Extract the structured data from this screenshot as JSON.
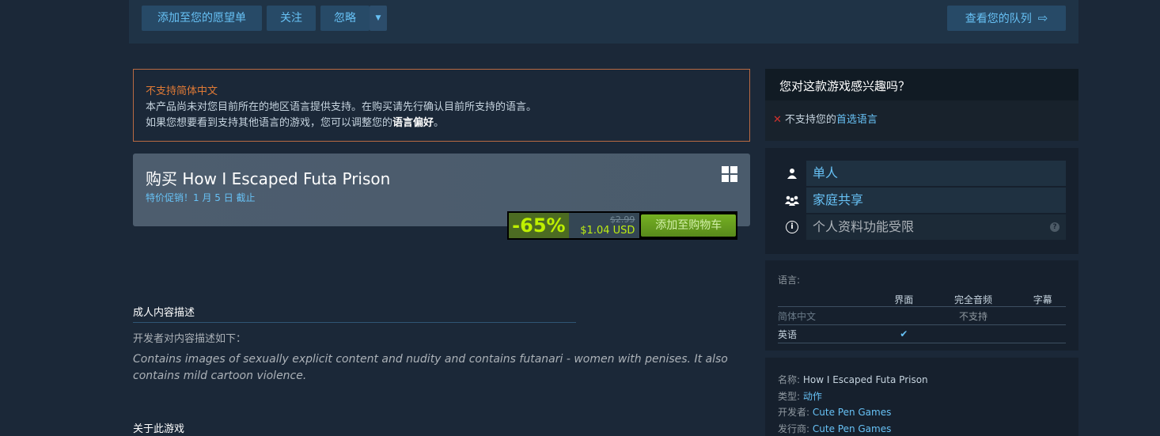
{
  "topbar": {
    "wishlist_label": "添加至您的愿望单",
    "follow_label": "关注",
    "ignore_label": "忽略",
    "queue_label": "查看您的队列"
  },
  "language_warning": {
    "title": "不支持简体中文",
    "line1": "本产品尚未对您目前所在的地区语言提供支持。在购买请先行确认目前所支持的语言。",
    "line2_prefix": "如果您想要看到支持其他语言的游戏，您可以调整您的",
    "line2_link": "语言偏好",
    "line2_suffix": "。"
  },
  "purchase": {
    "title": "购买 How I Escaped Futa Prison",
    "promo": "特价促销！1 月 5 日 截止",
    "discount": "-65%",
    "original_price": "$2.99",
    "final_price": "$1.04 USD",
    "cart_label": "添加至购物车"
  },
  "mature": {
    "heading": "成人内容描述",
    "intro": "开发者对内容描述如下：",
    "text": "Contains images of sexually explicit content and nudity and contains futanari - women with penises. It also contains mild cartoon violence."
  },
  "about": {
    "heading": "关于此游戏"
  },
  "interest": {
    "question": "您对这款游戏感兴趣吗？",
    "not_supported_prefix": "不支持您的",
    "not_supported_link": "首选语言"
  },
  "features": [
    {
      "icon": "single-player-icon",
      "label": "单人"
    },
    {
      "icon": "family-sharing-icon",
      "label": "家庭共享"
    },
    {
      "icon": "info-icon",
      "label": "个人资料功能受限"
    }
  ],
  "languages": {
    "title": "语言:",
    "headers": [
      "界面",
      "完全音频",
      "字幕"
    ],
    "rows": [
      {
        "name": "简体中文",
        "status": "不支持"
      },
      {
        "name": "英语",
        "interface": "✔"
      }
    ]
  },
  "details": {
    "name_key": "名称:",
    "name_val": "How I Escaped Futa Prison",
    "genre_key": "类型:",
    "genre_val": "动作",
    "dev_key": "开发者:",
    "dev_val": "Cute Pen Games",
    "pub_key": "发行商:",
    "pub_val": "Cute Pen Games"
  },
  "colors": {
    "background": "#1b2838",
    "link": "#67c1f5",
    "discount_text": "#bef000",
    "warning": "#e07a36"
  }
}
